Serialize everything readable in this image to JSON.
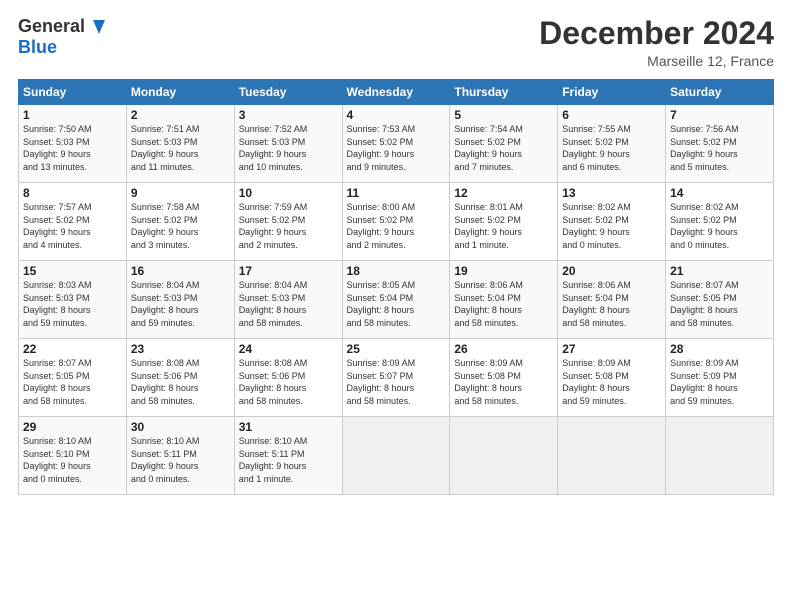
{
  "logo": {
    "line1": "General",
    "line2": "Blue"
  },
  "header": {
    "month": "December 2024",
    "location": "Marseille 12, France"
  },
  "days_of_week": [
    "Sunday",
    "Monday",
    "Tuesday",
    "Wednesday",
    "Thursday",
    "Friday",
    "Saturday"
  ],
  "weeks": [
    [
      {
        "day": "1",
        "info": "Sunrise: 7:50 AM\nSunset: 5:03 PM\nDaylight: 9 hours\nand 13 minutes."
      },
      {
        "day": "2",
        "info": "Sunrise: 7:51 AM\nSunset: 5:03 PM\nDaylight: 9 hours\nand 11 minutes."
      },
      {
        "day": "3",
        "info": "Sunrise: 7:52 AM\nSunset: 5:03 PM\nDaylight: 9 hours\nand 10 minutes."
      },
      {
        "day": "4",
        "info": "Sunrise: 7:53 AM\nSunset: 5:02 PM\nDaylight: 9 hours\nand 9 minutes."
      },
      {
        "day": "5",
        "info": "Sunrise: 7:54 AM\nSunset: 5:02 PM\nDaylight: 9 hours\nand 7 minutes."
      },
      {
        "day": "6",
        "info": "Sunrise: 7:55 AM\nSunset: 5:02 PM\nDaylight: 9 hours\nand 6 minutes."
      },
      {
        "day": "7",
        "info": "Sunrise: 7:56 AM\nSunset: 5:02 PM\nDaylight: 9 hours\nand 5 minutes."
      }
    ],
    [
      {
        "day": "8",
        "info": "Sunrise: 7:57 AM\nSunset: 5:02 PM\nDaylight: 9 hours\nand 4 minutes."
      },
      {
        "day": "9",
        "info": "Sunrise: 7:58 AM\nSunset: 5:02 PM\nDaylight: 9 hours\nand 3 minutes."
      },
      {
        "day": "10",
        "info": "Sunrise: 7:59 AM\nSunset: 5:02 PM\nDaylight: 9 hours\nand 2 minutes."
      },
      {
        "day": "11",
        "info": "Sunrise: 8:00 AM\nSunset: 5:02 PM\nDaylight: 9 hours\nand 2 minutes."
      },
      {
        "day": "12",
        "info": "Sunrise: 8:01 AM\nSunset: 5:02 PM\nDaylight: 9 hours\nand 1 minute."
      },
      {
        "day": "13",
        "info": "Sunrise: 8:02 AM\nSunset: 5:02 PM\nDaylight: 9 hours\nand 0 minutes."
      },
      {
        "day": "14",
        "info": "Sunrise: 8:02 AM\nSunset: 5:02 PM\nDaylight: 9 hours\nand 0 minutes."
      }
    ],
    [
      {
        "day": "15",
        "info": "Sunrise: 8:03 AM\nSunset: 5:03 PM\nDaylight: 8 hours\nand 59 minutes."
      },
      {
        "day": "16",
        "info": "Sunrise: 8:04 AM\nSunset: 5:03 PM\nDaylight: 8 hours\nand 59 minutes."
      },
      {
        "day": "17",
        "info": "Sunrise: 8:04 AM\nSunset: 5:03 PM\nDaylight: 8 hours\nand 58 minutes."
      },
      {
        "day": "18",
        "info": "Sunrise: 8:05 AM\nSunset: 5:04 PM\nDaylight: 8 hours\nand 58 minutes."
      },
      {
        "day": "19",
        "info": "Sunrise: 8:06 AM\nSunset: 5:04 PM\nDaylight: 8 hours\nand 58 minutes."
      },
      {
        "day": "20",
        "info": "Sunrise: 8:06 AM\nSunset: 5:04 PM\nDaylight: 8 hours\nand 58 minutes."
      },
      {
        "day": "21",
        "info": "Sunrise: 8:07 AM\nSunset: 5:05 PM\nDaylight: 8 hours\nand 58 minutes."
      }
    ],
    [
      {
        "day": "22",
        "info": "Sunrise: 8:07 AM\nSunset: 5:05 PM\nDaylight: 8 hours\nand 58 minutes."
      },
      {
        "day": "23",
        "info": "Sunrise: 8:08 AM\nSunset: 5:06 PM\nDaylight: 8 hours\nand 58 minutes."
      },
      {
        "day": "24",
        "info": "Sunrise: 8:08 AM\nSunset: 5:06 PM\nDaylight: 8 hours\nand 58 minutes."
      },
      {
        "day": "25",
        "info": "Sunrise: 8:09 AM\nSunset: 5:07 PM\nDaylight: 8 hours\nand 58 minutes."
      },
      {
        "day": "26",
        "info": "Sunrise: 8:09 AM\nSunset: 5:08 PM\nDaylight: 8 hours\nand 58 minutes."
      },
      {
        "day": "27",
        "info": "Sunrise: 8:09 AM\nSunset: 5:08 PM\nDaylight: 8 hours\nand 59 minutes."
      },
      {
        "day": "28",
        "info": "Sunrise: 8:09 AM\nSunset: 5:09 PM\nDaylight: 8 hours\nand 59 minutes."
      }
    ],
    [
      {
        "day": "29",
        "info": "Sunrise: 8:10 AM\nSunset: 5:10 PM\nDaylight: 9 hours\nand 0 minutes."
      },
      {
        "day": "30",
        "info": "Sunrise: 8:10 AM\nSunset: 5:11 PM\nDaylight: 9 hours\nand 0 minutes."
      },
      {
        "day": "31",
        "info": "Sunrise: 8:10 AM\nSunset: 5:11 PM\nDaylight: 9 hours\nand 1 minute."
      },
      {
        "day": "",
        "info": ""
      },
      {
        "day": "",
        "info": ""
      },
      {
        "day": "",
        "info": ""
      },
      {
        "day": "",
        "info": ""
      }
    ]
  ]
}
